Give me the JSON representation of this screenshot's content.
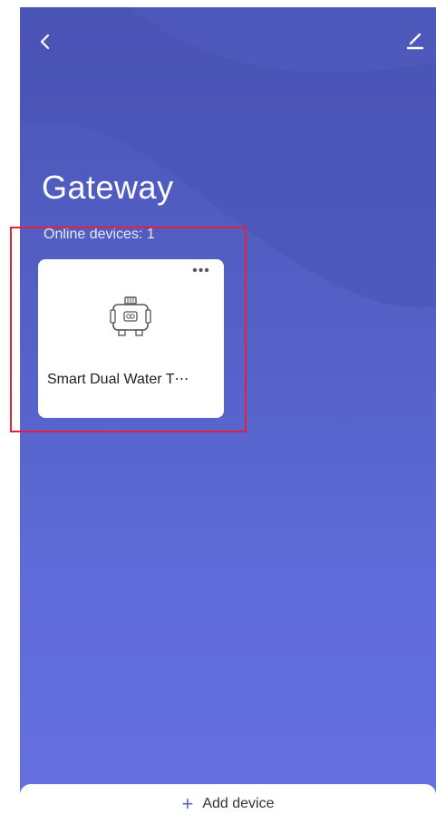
{
  "header": {
    "back_icon": "chevron-left-icon",
    "edit_icon": "pencil-icon",
    "title": "Gateway",
    "online_devices": "Online devices: 1"
  },
  "devices": [
    {
      "name": "Smart Dual Water T⋯",
      "more_label": "•••",
      "icon": "water-timer-icon"
    }
  ],
  "footer": {
    "plus_label": "+",
    "add_device_label": "Add device"
  },
  "colors": {
    "background_top": "#4b55b6",
    "background_bottom": "#6670e2",
    "accent": "#5a63c8",
    "highlight": "#e0233a"
  }
}
